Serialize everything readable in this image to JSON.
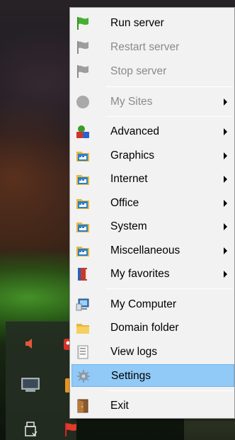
{
  "menu": {
    "items": [
      {
        "label": "Run server",
        "icon": "green-flag-icon",
        "disabled": false,
        "submenu": false
      },
      {
        "label": "Restart server",
        "icon": "grey-flag-icon",
        "disabled": true,
        "submenu": false
      },
      {
        "label": "Stop server",
        "icon": "grey-flag-icon",
        "disabled": true,
        "submenu": false
      },
      {
        "label": "My Sites",
        "icon": "grey-circle-icon",
        "disabled": true,
        "submenu": true
      },
      {
        "label": "Advanced",
        "icon": "advanced-shapes-icon",
        "disabled": false,
        "submenu": true
      },
      {
        "label": "Graphics",
        "icon": "folder-app-icon",
        "disabled": false,
        "submenu": true
      },
      {
        "label": "Internet",
        "icon": "folder-app-icon",
        "disabled": false,
        "submenu": true
      },
      {
        "label": "Office",
        "icon": "folder-app-icon",
        "disabled": false,
        "submenu": true
      },
      {
        "label": "System",
        "icon": "folder-app-icon",
        "disabled": false,
        "submenu": true
      },
      {
        "label": "Miscellaneous",
        "icon": "folder-app-icon",
        "disabled": false,
        "submenu": true
      },
      {
        "label": "My favorites",
        "icon": "book-icon",
        "disabled": false,
        "submenu": true
      },
      {
        "label": "My Computer",
        "icon": "computer-icon",
        "disabled": false,
        "submenu": false
      },
      {
        "label": "Domain folder",
        "icon": "folder-icon",
        "disabled": false,
        "submenu": false
      },
      {
        "label": "View logs",
        "icon": "log-document-icon",
        "disabled": false,
        "submenu": false
      },
      {
        "label": "Settings",
        "icon": "gear-icon",
        "disabled": false,
        "submenu": false,
        "highlighted": true
      },
      {
        "label": "Exit",
        "icon": "exit-door-icon",
        "disabled": false,
        "submenu": false
      }
    ]
  },
  "tray": {
    "icons": [
      "volume-icon",
      "red-app-icon",
      "display-icon",
      "orange-app-icon",
      "usb-drive-icon",
      "red-flag-icon"
    ]
  },
  "colors": {
    "highlight": "#91c9f7",
    "menu_background": "#f2f2f2",
    "disabled_text": "#8a8a8a"
  }
}
